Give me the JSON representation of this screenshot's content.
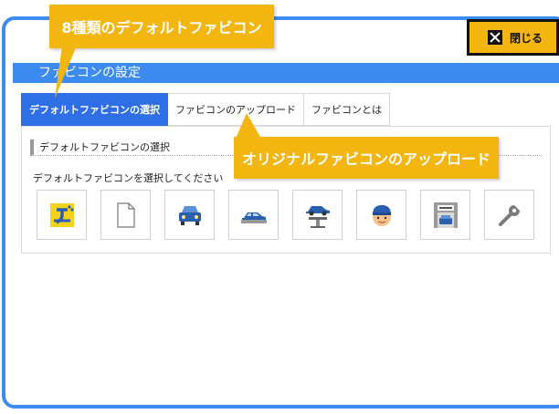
{
  "callouts": {
    "default_eight": "8種類のデフォルトファビコン",
    "original_upload": "オリジナルファビコンのアップロード"
  },
  "toolbar": {
    "close_label": "閉じる"
  },
  "settings": {
    "header": "ファビコンの設定"
  },
  "tabs": [
    {
      "label": "デフォルトファビコンの選択",
      "active": true
    },
    {
      "label": "ファビコンのアップロード",
      "active": false
    },
    {
      "label": "ファビコンとは",
      "active": false
    }
  ],
  "panel": {
    "section_title": "デフォルトファビコンの選択",
    "instruction": "デフォルトファビコンを選択してください"
  },
  "favicons": [
    {
      "name": "de-logo-icon"
    },
    {
      "name": "blank-document-icon"
    },
    {
      "name": "car-front-icon"
    },
    {
      "name": "car-side-icon"
    },
    {
      "name": "car-lift-icon"
    },
    {
      "name": "mechanic-face-icon"
    },
    {
      "name": "car-garage-icon"
    },
    {
      "name": "wrench-icon"
    }
  ],
  "colors": {
    "frame_blue": "#3d8bf0",
    "tab_active": "#2f6fe6",
    "callout_yellow": "#f3b510",
    "car_blue": "#2a5fb0"
  }
}
